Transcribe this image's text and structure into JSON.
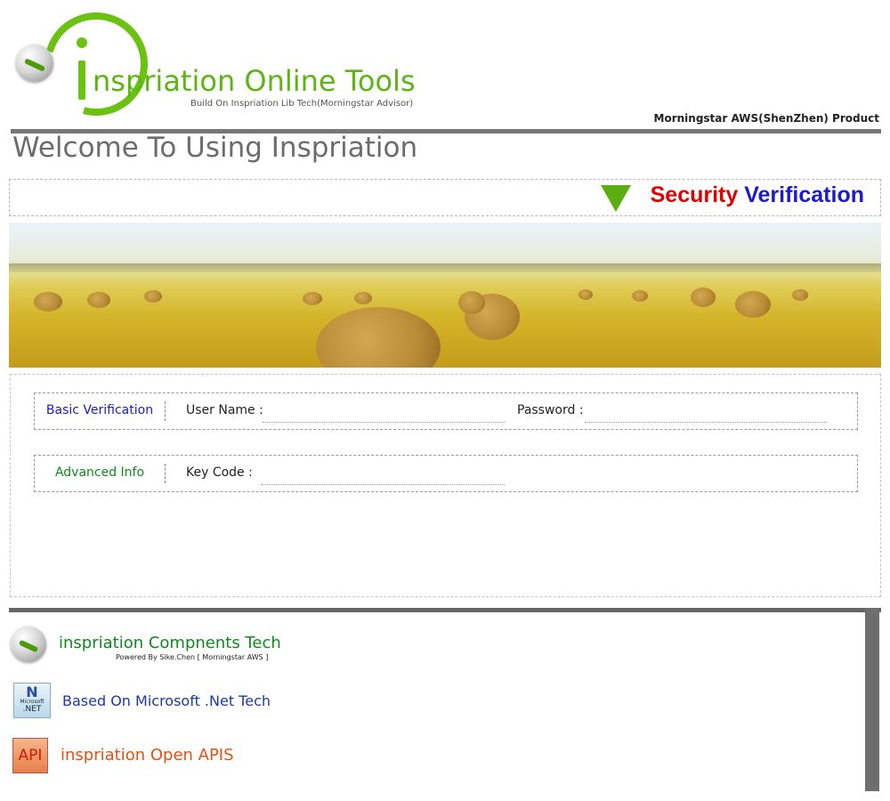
{
  "header": {
    "logo_title": "nspriation Online Tools",
    "logo_subtitle": "Build On Inspriation Lib Tech(Morningstar Advisor)",
    "product": "Morningstar AWS(ShenZhen) Product"
  },
  "welcome": "Welcome To Using Inspriation",
  "security": {
    "word1": "Security",
    "word2": "Verification",
    "colors": {
      "word1": "#e00000",
      "word2": "#1a1ad0",
      "triangle": "#5aae10"
    }
  },
  "form": {
    "basic": {
      "label": "Basic Verification",
      "username_label": "User Name :",
      "username_value": "",
      "password_label": "Password :",
      "password_value": ""
    },
    "advanced": {
      "label": "Advanced Info",
      "keycode_label": "Key Code :",
      "keycode_value": ""
    }
  },
  "footer": {
    "components": "inspriation Compnents Tech",
    "powered": "Powered By Sike.Chen [ Morningstar AWS ]",
    "dotnet": "Based On Microsoft .Net Tech",
    "dotnet_icon_ms": "Microsoft",
    "dotnet_icon": ".NET",
    "api_icon": "API",
    "api": "inspriation Open APIS"
  }
}
